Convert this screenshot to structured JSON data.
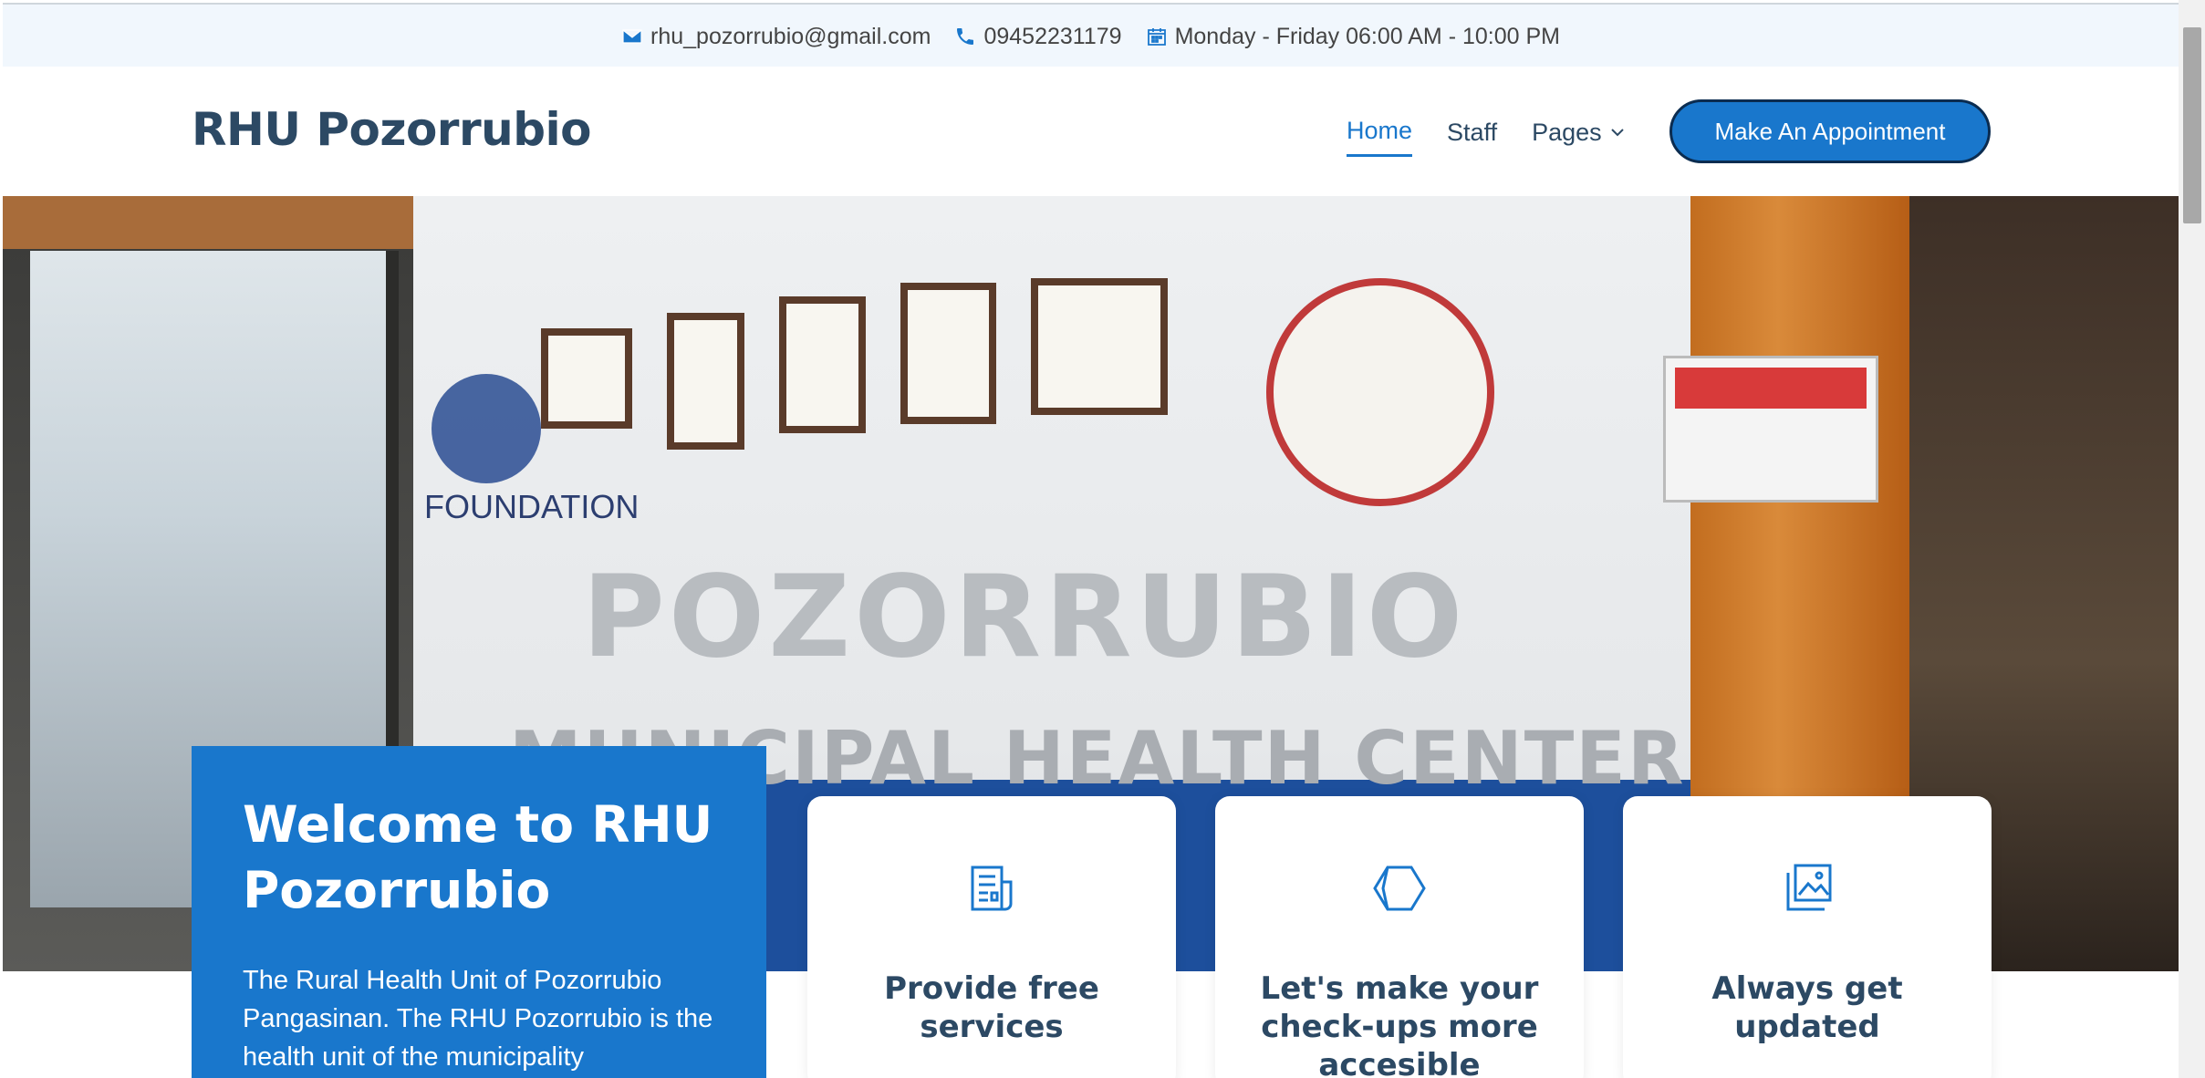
{
  "topbar": {
    "email": "rhu_pozorrubio@gmail.com",
    "phone": "09452231179",
    "hours": "Monday - Friday 06:00 AM - 10:00 PM",
    "icons": [
      "envelope-icon",
      "phone-icon",
      "calendar-icon"
    ]
  },
  "header": {
    "logo": "RHU Pozorrubio",
    "nav": [
      {
        "label": "Home",
        "active": true
      },
      {
        "label": "Staff",
        "active": false
      },
      {
        "label": "Pages",
        "active": false
      }
    ],
    "cta_label": "Make An Appointment"
  },
  "hero": {
    "welcome_title": "Welcome to RHU Pozorrubio",
    "welcome_text": "The Rural Health Unit of Pozorrubio Pangasinan. The RHU Pozorrubio is the health unit of the municipality"
  },
  "features": [
    {
      "icon": "document-icon",
      "title": "Provide free services"
    },
    {
      "icon": "hexagon-icon",
      "title": "Let's make your check-ups more accesible"
    },
    {
      "icon": "images-icon",
      "title": "Always get updated"
    }
  ],
  "colors": {
    "accent": "#1977cc",
    "heading": "#2c4964",
    "topbar_bg": "#f1f7fd"
  }
}
